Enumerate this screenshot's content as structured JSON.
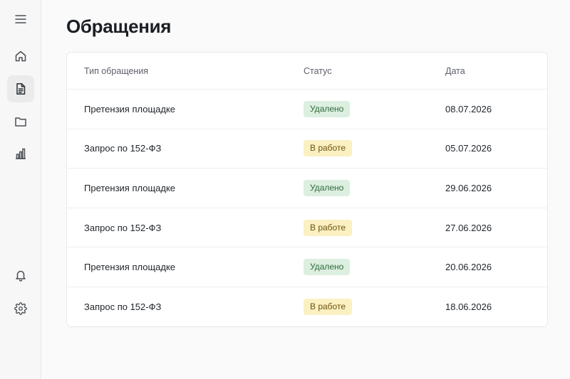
{
  "sidebar": {
    "items": [
      {
        "icon": "menu-icon"
      },
      {
        "icon": "home-icon"
      },
      {
        "icon": "document-icon",
        "active": true
      },
      {
        "icon": "folder-icon"
      },
      {
        "icon": "chart-icon"
      },
      {
        "icon": "bell-icon"
      },
      {
        "icon": "gear-icon"
      }
    ]
  },
  "page": {
    "title": "Обращения"
  },
  "table": {
    "columns": [
      "Тип обращения",
      "Статус",
      "Дата"
    ],
    "rows": [
      {
        "type": "Претензия площадке",
        "status": "Удалено",
        "date": "08.07.2026"
      },
      {
        "type": "Запрос по 152-ФЗ",
        "status": "В работе",
        "date": "05.07.2026"
      },
      {
        "type": "Претензия площадке",
        "status": "Удалено",
        "date": "29.06.2026"
      },
      {
        "type": "Запрос по 152-ФЗ",
        "status": "В работе",
        "date": "27.06.2026"
      },
      {
        "type": "Претензия площадке",
        "status": "Удалено",
        "date": "20.06.2026"
      },
      {
        "type": "Запрос по 152-ФЗ",
        "status": "В работе",
        "date": "18.06.2026"
      }
    ]
  },
  "status_colors": {
    "Удалено": {
      "bg": "#dcefe0",
      "fg": "#2f6b3e"
    },
    "В работе": {
      "bg": "#fbf0c2",
      "fg": "#6b5510"
    }
  }
}
